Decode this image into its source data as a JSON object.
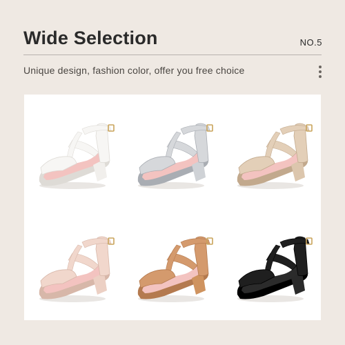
{
  "header": {
    "title": "Wide Selection",
    "badge": "NO.5",
    "subtitle": "Unique design, fashion color, offer you free choice"
  },
  "products": [
    {
      "variant": "white",
      "color": "#f7f6f4",
      "shade": "#dedbd6",
      "heel": "#f1efec"
    },
    {
      "variant": "silver-glitter",
      "color": "#d6d8db",
      "shade": "#a9adb3",
      "heel": "#cfd2d6"
    },
    {
      "variant": "champagne-glitter",
      "color": "#e3cfb8",
      "shade": "#c2a98d",
      "heel": "#dcc6ad"
    },
    {
      "variant": "nude-pink",
      "color": "#f1d7cc",
      "shade": "#d7b7a9",
      "heel": "#ecd0c4"
    },
    {
      "variant": "tan",
      "color": "#d49a6d",
      "shade": "#b47a4f",
      "heel": "#cf935f"
    },
    {
      "variant": "black",
      "color": "#1f1f1f",
      "shade": "#000000",
      "heel": "#2a2a2a"
    }
  ],
  "icons": {
    "menu": "more-vertical-icon"
  }
}
